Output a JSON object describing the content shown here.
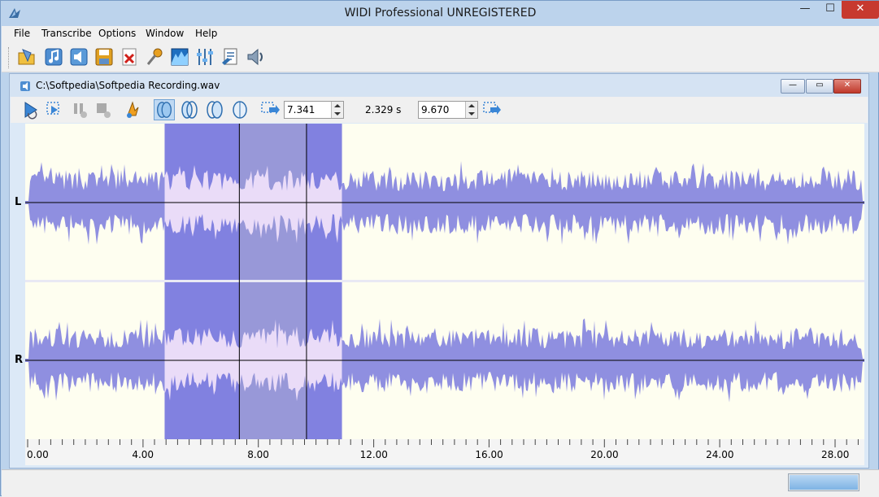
{
  "window": {
    "title": "WIDI Professional UNREGISTERED",
    "buttons": {
      "minimize": "—",
      "maximize": "☐",
      "close": "✕"
    }
  },
  "menu": [
    "File",
    "Transcribe",
    "Options",
    "Window",
    "Help"
  ],
  "toolbar": {
    "icons": [
      "open-folder-icon",
      "music-note-icon",
      "speaker-icon",
      "save-disk-icon",
      "close-file-icon",
      "microphone-icon",
      "spectrum-icon",
      "equalizer-icon",
      "properties-icon",
      "volume-icon"
    ]
  },
  "document": {
    "title": "C:\\Softpedia\\Softpedia Recording.wav",
    "buttons": {
      "minimize": "—",
      "maximize": "▭",
      "close": "✕"
    },
    "selection_start": "7.341",
    "selection_length": "2.329 s",
    "selection_end": "9.670",
    "channels": [
      "L",
      "R"
    ],
    "ruler_labels": [
      "0.00",
      "4.00",
      "8.00",
      "12.00",
      "16.00",
      "20.00",
      "24.00",
      "28.00"
    ],
    "ruler_max_seconds": 30,
    "highlight_start_seconds": 4.75,
    "highlight_end_seconds": 10.9,
    "markers_seconds": [
      7.341,
      9.67
    ]
  },
  "colors": {
    "wave": "#8f8fe0",
    "wave_highlight": "#eadcf8",
    "highlight_bg": "#8181e0",
    "selection_bg": "#9898d8",
    "wave_bg": "#fefef0"
  },
  "status": {
    "progress": 1.0
  }
}
